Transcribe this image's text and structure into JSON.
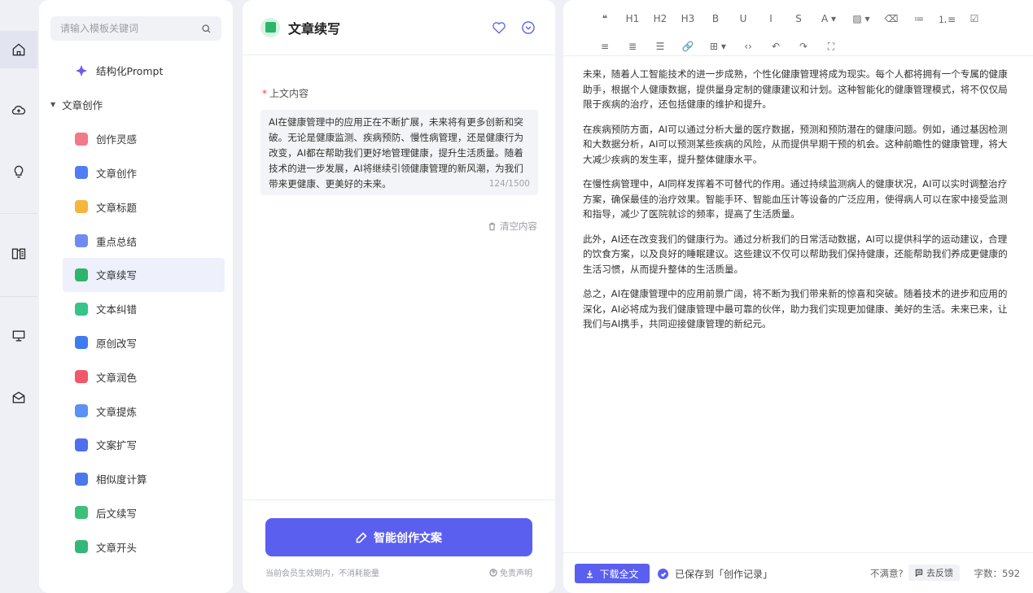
{
  "rail": {
    "items": [
      "home-icon",
      "cloud-icon",
      "bulb-icon",
      "book-icon",
      "monitor-icon",
      "mail-icon"
    ]
  },
  "templates": {
    "search_placeholder": "请输入模板关键词",
    "top_item": "结构化Prompt",
    "group_label": "文章创作",
    "items": [
      {
        "label": "创作灵感",
        "color": "#f27a86"
      },
      {
        "label": "文章创作",
        "color": "#4f7df5"
      },
      {
        "label": "文章标题",
        "color": "#f5b63c"
      },
      {
        "label": "重点总结",
        "color": "#6e8cf0"
      },
      {
        "label": "文章续写",
        "color": "#2cb56b"
      },
      {
        "label": "文本纠错",
        "color": "#35c48a"
      },
      {
        "label": "原创改写",
        "color": "#3d7bf0"
      },
      {
        "label": "文章润色",
        "color": "#f0596a"
      },
      {
        "label": "文章提炼",
        "color": "#5a92f5"
      },
      {
        "label": "文案扩写",
        "color": "#4d6ff0"
      },
      {
        "label": "相似度计算",
        "color": "#4a78ee"
      },
      {
        "label": "后文续写",
        "color": "#3cc07a"
      },
      {
        "label": "文章开头",
        "color": "#34b87a"
      }
    ]
  },
  "mid": {
    "title": "文章续写",
    "field_required": "*",
    "field_label": "上文内容",
    "context_text": "AI在健康管理中的应用正在不断扩展，未来将有更多创新和突破。无论是健康监测、疾病预防、慢性病管理，还是健康行为改变，AI都在帮助我们更好地管理健康，提升生活质量。随着技术的进一步发展，AI将继续引领健康管理的新风潮，为我们带来更健康、更美好的未来。",
    "char_count": "124/1500",
    "clear_label": "清空内容",
    "generate_label": "智能创作文案",
    "member_note": "当前会员生效期内，不消耗能量",
    "disclaimer_label": "免责声明"
  },
  "editor": {
    "toolbar_row1": [
      "❝",
      "H1",
      "H2",
      "H3",
      "B",
      "U",
      "I",
      "S",
      "A ▾",
      "▨ ▾",
      "⌫",
      "≔",
      "⒈≡",
      "☑"
    ],
    "toolbar_row2": [
      "≡",
      "≣",
      "☰",
      "🔗",
      "⊞ ▾",
      "‹›",
      "↶",
      "↷",
      "⛶"
    ],
    "paragraphs": [
      "未来，随着人工智能技术的进一步成熟，个性化健康管理将成为现实。每个人都将拥有一个专属的健康助手，根据个人健康数据，提供量身定制的健康建议和计划。这种智能化的健康管理模式，将不仅仅局限于疾病的治疗，还包括健康的维护和提升。",
      "在疾病预防方面，AI可以通过分析大量的医疗数据，预测和预防潜在的健康问题。例如，通过基因检测和大数据分析，AI可以预测某些疾病的风险，从而提供早期干预的机会。这种前瞻性的健康管理，将大大减少疾病的发生率，提升整体健康水平。",
      "在慢性病管理中，AI同样发挥着不可替代的作用。通过持续监测病人的健康状况，AI可以实时调整治疗方案，确保最佳的治疗效果。智能手环、智能血压计等设备的广泛应用，使得病人可以在家中接受监测和指导，减少了医院就诊的频率，提高了生活质量。",
      "此外，AI还在改变我们的健康行为。通过分析我们的日常活动数据，AI可以提供科学的运动建议，合理的饮食方案，以及良好的睡眠建议。这些建议不仅可以帮助我们保持健康，还能帮助我们养成更健康的生活习惯，从而提升整体的生活质量。",
      "总之，AI在健康管理中的应用前景广阔，将不断为我们带来新的惊喜和突破。随着技术的进步和应用的深化，AI必将成为我们健康管理中最可靠的伙伴，助力我们实现更加健康、美好的生活。未来已来，让我们与AI携手，共同迎接健康管理的新纪元。"
    ],
    "download_label": "下载全文",
    "saved_label": "已保存到「创作记录」",
    "unsatisfied_label": "不满意?",
    "feedback_label": "去反馈",
    "word_count_label": "字数：592"
  }
}
